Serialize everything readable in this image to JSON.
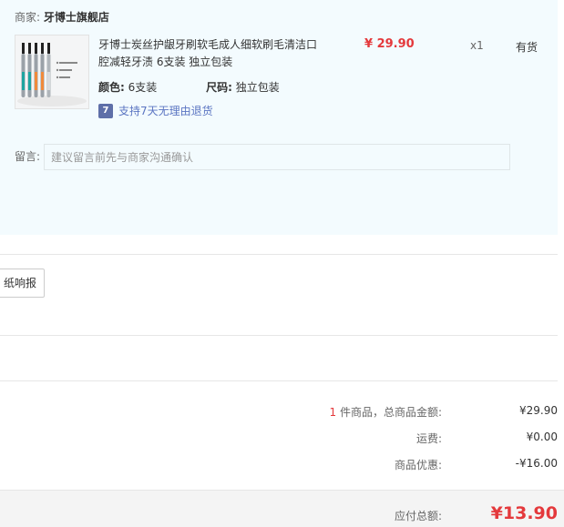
{
  "merchant": {
    "label": "商家:",
    "name": "牙博士旗舰店"
  },
  "product": {
    "title": "牙博士炭丝护龈牙刷软毛成人细软刷毛清洁口腔减轻牙渍 6支装 独立包装",
    "price": "¥ 29.90",
    "quantity": "x1",
    "stock_status": "有货",
    "color_label": "颜色:",
    "color_value": "6支装",
    "size_label": "尺码:",
    "size_value": "独立包装",
    "return_badge": "7",
    "return_policy": "支持7天无理由退货",
    "image_icon": "toothbrush-product-image"
  },
  "remark": {
    "label": "留言:",
    "placeholder": "建议留言前先与商家沟通确认"
  },
  "invoice": {
    "button_label": "纸响报销"
  },
  "summary": {
    "item_count": "1",
    "item_count_suffix": " 件商品，总商品金额:",
    "goods_amount": "¥29.90",
    "shipping_label": "运费:",
    "shipping_amount": "¥0.00",
    "discount_label": "商品优惠:",
    "discount_amount": "-¥16.00",
    "payable_label": "应付总额:",
    "payable_amount": "¥13.90"
  },
  "colors": {
    "accent_red": "#e4393c",
    "panel_bg": "#f3fbfe",
    "link_blue": "#5b75c2"
  }
}
